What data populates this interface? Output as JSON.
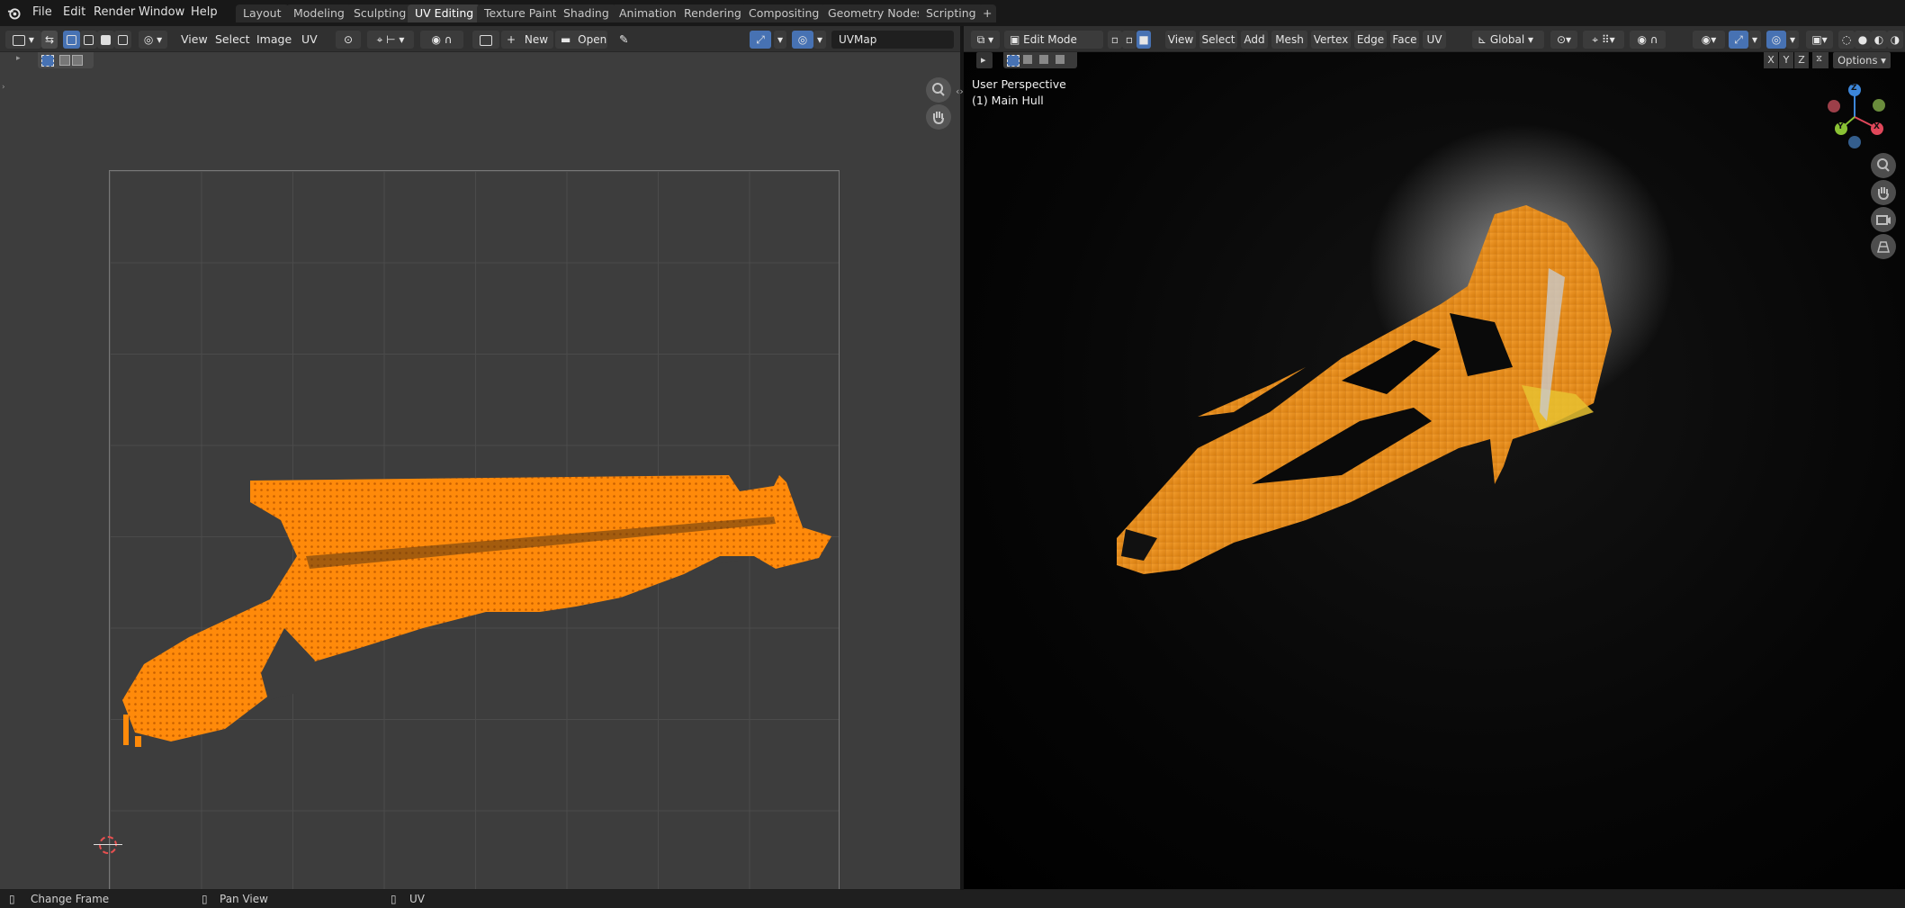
{
  "topbar": {
    "menus": [
      "File",
      "Edit",
      "Render",
      "Window",
      "Help"
    ],
    "workspaces": [
      "Layout",
      "Modeling",
      "Sculpting",
      "UV Editing",
      "Texture Paint",
      "Shading",
      "Animation",
      "Rendering",
      "Compositing",
      "Geometry Nodes",
      "Scripting"
    ],
    "active_workspace": "UV Editing",
    "add_tab": "+"
  },
  "uv_editor": {
    "menus": [
      "View",
      "Select",
      "Image",
      "UV"
    ],
    "new_label": "New",
    "open_label": "Open",
    "uvmap_field": "UVMap"
  },
  "viewport": {
    "mode": "Edit Mode",
    "menus": [
      "View",
      "Select",
      "Add",
      "Mesh",
      "Vertex",
      "Edge",
      "Face",
      "UV"
    ],
    "transform_orientation": "Global",
    "axis_lock": [
      "X",
      "Y",
      "Z"
    ],
    "options_label": "Options",
    "overlay_title": "User Perspective",
    "overlay_object": "(1) Main Hull",
    "gizmo_axes": {
      "x": "X",
      "y": "Y",
      "z": "Z"
    },
    "colors": {
      "x": "#e0475a",
      "y": "#8ac234",
      "z": "#3c86d9"
    }
  },
  "statusbar": {
    "items": [
      "Change Frame",
      "Pan View",
      "UV"
    ]
  },
  "colors": {
    "uv_orange": "#ff8a0a",
    "active_tab_blue": "#4772b3"
  }
}
